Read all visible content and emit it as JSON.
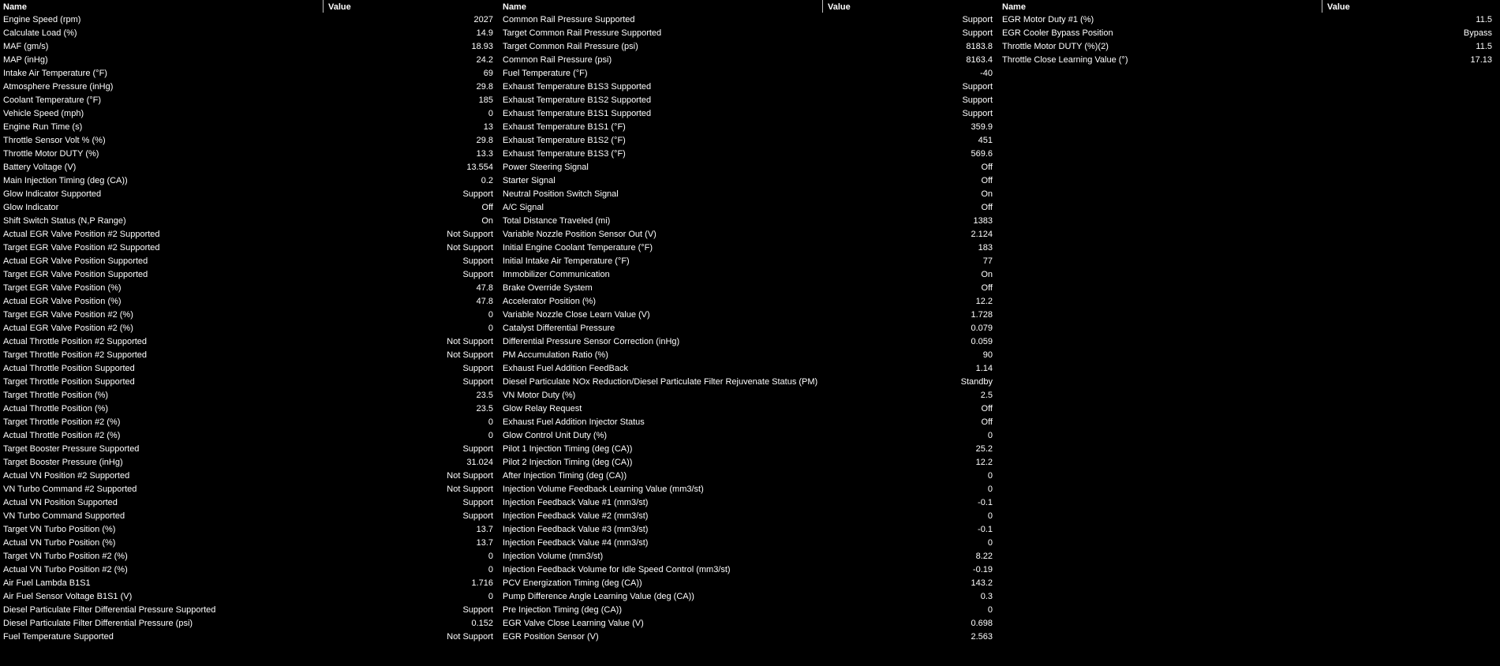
{
  "headers": {
    "name": "Name",
    "value": "Value"
  },
  "panels": [
    {
      "rows": [
        {
          "name": "Engine Speed (rpm)",
          "value": "2027"
        },
        {
          "name": "Calculate Load (%)",
          "value": "14.9"
        },
        {
          "name": "MAF (gm/s)",
          "value": "18.93"
        },
        {
          "name": "MAP (inHg)",
          "value": "24.2"
        },
        {
          "name": "Intake Air Temperature (°F)",
          "value": "69"
        },
        {
          "name": "Atmosphere Pressure (inHg)",
          "value": "29.8"
        },
        {
          "name": "Coolant Temperature (°F)",
          "value": "185"
        },
        {
          "name": "Vehicle Speed (mph)",
          "value": "0"
        },
        {
          "name": "Engine Run Time (s)",
          "value": "13"
        },
        {
          "name": "Throttle Sensor Volt % (%)",
          "value": "29.8"
        },
        {
          "name": "Throttle Motor DUTY (%)",
          "value": "13.3"
        },
        {
          "name": "Battery Voltage (V)",
          "value": "13.554"
        },
        {
          "name": "Main Injection Timing (deg (CA))",
          "value": "0.2"
        },
        {
          "name": "Glow Indicator Supported",
          "value": "Support"
        },
        {
          "name": "Glow Indicator",
          "value": "Off"
        },
        {
          "name": "Shift Switch Status (N,P Range)",
          "value": "On"
        },
        {
          "name": "Actual EGR Valve Position #2 Supported",
          "value": "Not Support"
        },
        {
          "name": "Target EGR Valve Position #2 Supported",
          "value": "Not Support"
        },
        {
          "name": "Actual EGR Valve Position Supported",
          "value": "Support"
        },
        {
          "name": "Target EGR Valve Position Supported",
          "value": "Support"
        },
        {
          "name": "Target EGR Valve Position (%)",
          "value": "47.8"
        },
        {
          "name": "Actual EGR Valve Position (%)",
          "value": "47.8"
        },
        {
          "name": "Target EGR Valve Position #2 (%)",
          "value": "0"
        },
        {
          "name": "Actual EGR Valve Position #2 (%)",
          "value": "0"
        },
        {
          "name": "Actual Throttle Position #2 Supported",
          "value": "Not Support"
        },
        {
          "name": "Target Throttle Position #2 Supported",
          "value": "Not Support"
        },
        {
          "name": "Actual Throttle Position Supported",
          "value": "Support"
        },
        {
          "name": "Target Throttle Position Supported",
          "value": "Support"
        },
        {
          "name": "Target Throttle Position (%)",
          "value": "23.5"
        },
        {
          "name": "Actual Throttle Position (%)",
          "value": "23.5"
        },
        {
          "name": "Target Throttle Position #2 (%)",
          "value": "0"
        },
        {
          "name": "Actual Throttle Position #2 (%)",
          "value": "0"
        },
        {
          "name": "Target Booster Pressure Supported",
          "value": "Support"
        },
        {
          "name": "Target Booster Pressure (inHg)",
          "value": "31.024"
        },
        {
          "name": "Actual VN Position #2 Supported",
          "value": "Not Support"
        },
        {
          "name": "VN Turbo Command #2 Supported",
          "value": "Not Support"
        },
        {
          "name": "Actual VN Position Supported",
          "value": "Support"
        },
        {
          "name": "VN Turbo Command Supported",
          "value": "Support"
        },
        {
          "name": "Target VN Turbo Position (%)",
          "value": "13.7"
        },
        {
          "name": "Actual VN Turbo Position (%)",
          "value": "13.7"
        },
        {
          "name": "Target VN Turbo Position #2 (%)",
          "value": "0"
        },
        {
          "name": "Actual VN Turbo Position #2 (%)",
          "value": "0"
        },
        {
          "name": "Air Fuel Lambda B1S1",
          "value": "1.716"
        },
        {
          "name": "Air Fuel Sensor Voltage B1S1 (V)",
          "value": "0"
        },
        {
          "name": "Diesel Particulate Filter Differential Pressure Supported",
          "value": "Support"
        },
        {
          "name": "Diesel Particulate Filter Differential Pressure (psi)",
          "value": "0.152"
        },
        {
          "name": "Fuel Temperature Supported",
          "value": "Not Support"
        }
      ]
    },
    {
      "rows": [
        {
          "name": "Common Rail Pressure Supported",
          "value": "Support"
        },
        {
          "name": "Target Common Rail Pressure Supported",
          "value": "Support"
        },
        {
          "name": "Target Common Rail Pressure (psi)",
          "value": "8183.8"
        },
        {
          "name": "Common Rail Pressure (psi)",
          "value": "8163.4"
        },
        {
          "name": "Fuel Temperature (°F)",
          "value": "-40"
        },
        {
          "name": "Exhaust Temperature B1S3 Supported",
          "value": "Support"
        },
        {
          "name": "Exhaust Temperature B1S2 Supported",
          "value": "Support"
        },
        {
          "name": "Exhaust Temperature B1S1 Supported",
          "value": "Support"
        },
        {
          "name": "Exhaust Temperature B1S1 (°F)",
          "value": "359.9"
        },
        {
          "name": "Exhaust Temperature B1S2 (°F)",
          "value": "451"
        },
        {
          "name": "Exhaust Temperature B1S3 (°F)",
          "value": "569.6"
        },
        {
          "name": "Power Steering Signal",
          "value": "Off"
        },
        {
          "name": "Starter Signal",
          "value": "Off"
        },
        {
          "name": "Neutral Position Switch Signal",
          "value": "On"
        },
        {
          "name": "A/C Signal",
          "value": "Off"
        },
        {
          "name": "Total Distance Traveled (mi)",
          "value": "1383"
        },
        {
          "name": "Variable Nozzle Position Sensor Out (V)",
          "value": "2.124"
        },
        {
          "name": "Initial Engine Coolant Temperature (°F)",
          "value": "183"
        },
        {
          "name": "Initial Intake Air Temperature (°F)",
          "value": "77"
        },
        {
          "name": "Immobilizer Communication",
          "value": "On"
        },
        {
          "name": "Brake Override System",
          "value": "Off"
        },
        {
          "name": "Accelerator Position (%)",
          "value": "12.2"
        },
        {
          "name": "Variable Nozzle Close Learn Value (V)",
          "value": "1.728"
        },
        {
          "name": "Catalyst Differential Pressure",
          "value": "0.079"
        },
        {
          "name": "Differential Pressure Sensor Correction (inHg)",
          "value": "0.059"
        },
        {
          "name": "PM Accumulation Ratio (%)",
          "value": "90"
        },
        {
          "name": "Exhaust Fuel Addition FeedBack",
          "value": "1.14"
        },
        {
          "name": "Diesel Particulate NOx Reduction/Diesel Particulate Filter Rejuvenate Status (PM)",
          "value": "Standby"
        },
        {
          "name": "VN Motor Duty (%)",
          "value": "2.5"
        },
        {
          "name": "Glow Relay Request",
          "value": "Off"
        },
        {
          "name": "Exhaust Fuel Addition Injector Status",
          "value": "Off"
        },
        {
          "name": "Glow Control Unit Duty (%)",
          "value": "0"
        },
        {
          "name": "Pilot 1 Injection Timing (deg (CA))",
          "value": "25.2"
        },
        {
          "name": "Pilot 2 Injection Timing (deg (CA))",
          "value": "12.2"
        },
        {
          "name": "After Injection Timing (deg (CA))",
          "value": "0"
        },
        {
          "name": "Injection Volume Feedback Learning Value (mm3/st)",
          "value": "0"
        },
        {
          "name": "Injection Feedback Value #1 (mm3/st)",
          "value": "-0.1"
        },
        {
          "name": "Injection Feedback Value #2 (mm3/st)",
          "value": "0"
        },
        {
          "name": "Injection Feedback Value #3 (mm3/st)",
          "value": "-0.1"
        },
        {
          "name": "Injection Feedback Value #4 (mm3/st)",
          "value": "0"
        },
        {
          "name": "Injection Volume (mm3/st)",
          "value": "8.22"
        },
        {
          "name": "Injection Feedback Volume for Idle Speed Control (mm3/st)",
          "value": "-0.19"
        },
        {
          "name": "PCV Energization Timing (deg (CA))",
          "value": "143.2"
        },
        {
          "name": "Pump Difference Angle Learning Value (deg (CA))",
          "value": "0.3"
        },
        {
          "name": "Pre Injection Timing (deg (CA))",
          "value": "0"
        },
        {
          "name": "EGR Valve Close Learning Value (V)",
          "value": "0.698"
        },
        {
          "name": "EGR Position Sensor  (V)",
          "value": "2.563"
        }
      ]
    },
    {
      "rows": [
        {
          "name": "EGR Motor Duty #1 (%)",
          "value": "11.5"
        },
        {
          "name": "EGR Cooler Bypass Position",
          "value": "Bypass"
        },
        {
          "name": "Throttle Motor DUTY (%)(2)",
          "value": "11.5"
        },
        {
          "name": "Throttle Close Learning Value (°)",
          "value": "17.13"
        }
      ]
    }
  ]
}
